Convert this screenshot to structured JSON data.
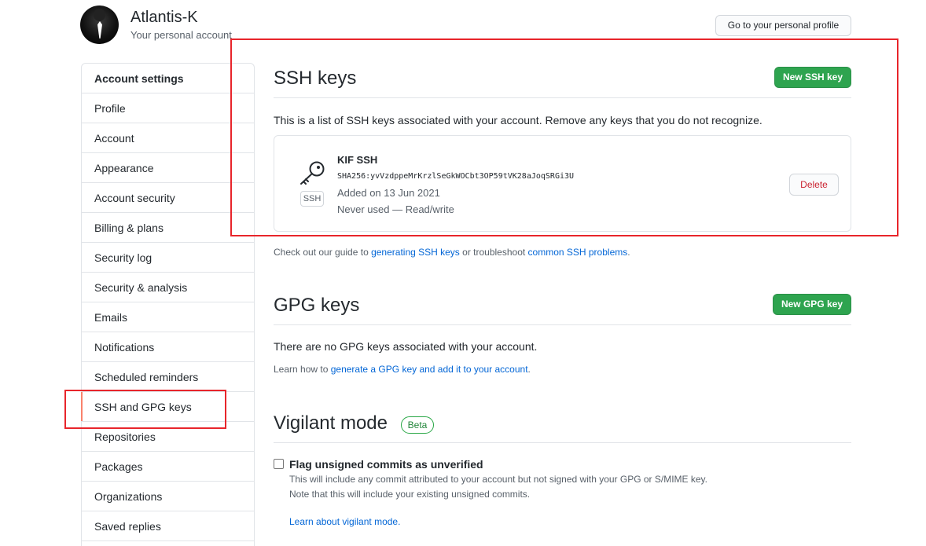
{
  "header": {
    "username": "Atlantis-K",
    "subtitle": "Your personal account",
    "profile_button": "Go to your personal profile"
  },
  "sidebar": {
    "heading": "Account settings",
    "items": [
      {
        "label": "Profile"
      },
      {
        "label": "Account"
      },
      {
        "label": "Appearance"
      },
      {
        "label": "Account security"
      },
      {
        "label": "Billing & plans"
      },
      {
        "label": "Security log"
      },
      {
        "label": "Security & analysis"
      },
      {
        "label": "Emails"
      },
      {
        "label": "Notifications"
      },
      {
        "label": "Scheduled reminders"
      },
      {
        "label": "SSH and GPG keys",
        "selected": true
      },
      {
        "label": "Repositories"
      },
      {
        "label": "Packages"
      },
      {
        "label": "Organizations"
      },
      {
        "label": "Saved replies"
      }
    ]
  },
  "ssh": {
    "title": "SSH keys",
    "new_button": "New SSH key",
    "description": "This is a list of SSH keys associated with your account. Remove any keys that you do not recognize.",
    "key": {
      "name": "KIF SSH",
      "fingerprint": "SHA256:yvVzdppeMrKrzlSeGkWOCbt3OP59tVK28aJoqSRGi3U",
      "added": "Added on 13 Jun 2021",
      "usage": "Never used — Read/write",
      "badge": "SSH",
      "delete_button": "Delete"
    },
    "guide_prefix": "Check out our guide to ",
    "guide_link1": "generating SSH keys",
    "guide_middle": " or troubleshoot ",
    "guide_link2": "common SSH problems",
    "guide_suffix": "."
  },
  "gpg": {
    "title": "GPG keys",
    "new_button": "New GPG key",
    "empty_text": "There are no GPG keys associated with your account.",
    "learn_prefix": "Learn how to ",
    "learn_link": "generate a GPG key and add it to your account",
    "learn_suffix": "."
  },
  "vigilant": {
    "title": "Vigilant mode",
    "badge": "Beta",
    "checkbox_label": "Flag unsigned commits as unverified",
    "desc1": "This will include any commit attributed to your account but not signed with your GPG or S/MIME key.",
    "desc2": "Note that this will include your existing unsigned commits.",
    "learn_link": "Learn about vigilant mode."
  },
  "colors": {
    "accent_green": "#2ea44f",
    "link_blue": "#0366d6",
    "danger_red": "#cb2431",
    "annotation_red": "#e8252b",
    "selected_marker": "#f9826c"
  }
}
